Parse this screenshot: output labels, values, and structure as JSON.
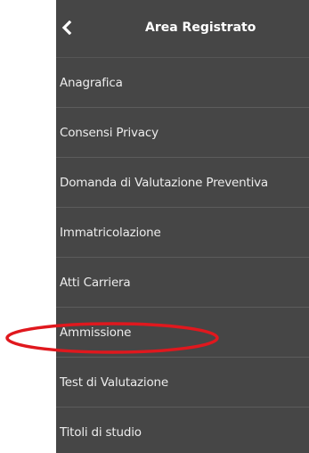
{
  "header": {
    "title": "Area Registrato",
    "back_icon": "chevron-left-icon"
  },
  "menu": {
    "items": [
      {
        "label": "Anagrafica"
      },
      {
        "label": "Consensi Privacy"
      },
      {
        "label": "Domanda di Valutazione Preventiva"
      },
      {
        "label": "Immatricolazione"
      },
      {
        "label": "Atti Carriera"
      },
      {
        "label": "Ammissione"
      },
      {
        "label": "Test di Valutazione"
      },
      {
        "label": "Titoli di studio"
      }
    ]
  },
  "colors": {
    "panel_background": "#464646",
    "text": "#ececec",
    "highlight": "#e0181e"
  }
}
